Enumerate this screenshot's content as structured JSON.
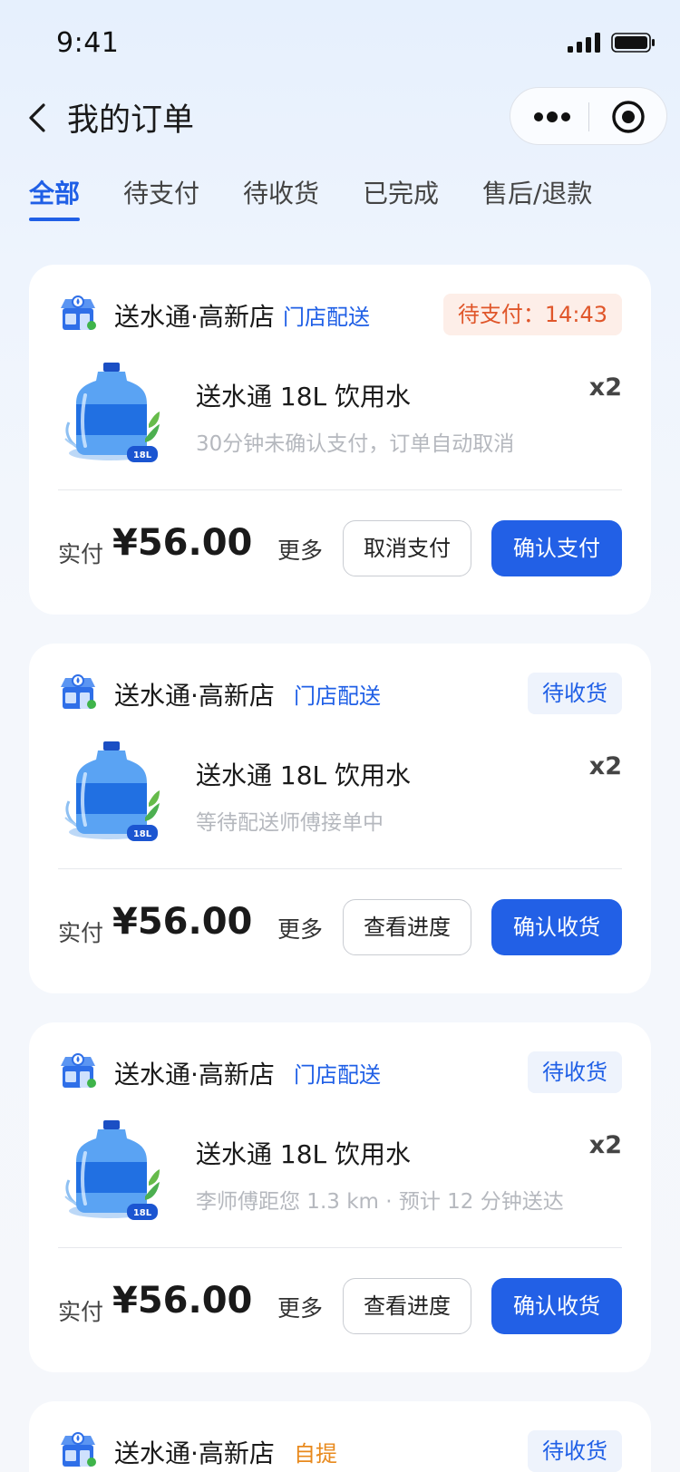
{
  "status_bar": {
    "time": "9:41",
    "signal_icon": "cellular-signal-icon",
    "battery_icon": "battery-icon"
  },
  "nav": {
    "title": "我的订单",
    "back_icon": "chevron-left-icon",
    "more_icon": "more-dots-icon",
    "capsule_icon": "target-circle-icon"
  },
  "tabs": [
    {
      "label": "全部",
      "active": true
    },
    {
      "label": "待支付",
      "active": false
    },
    {
      "label": "待收货",
      "active": false
    },
    {
      "label": "已完成",
      "active": false
    },
    {
      "label": "售后/退款",
      "active": false
    }
  ],
  "orders": [
    {
      "store": "送水通·高新店",
      "delivery": "门店配送",
      "status": "待支付：14:43",
      "product": "送水通 18L 饮用水",
      "qty": "x2",
      "note": "30分钟未确认支付，订单自动取消",
      "paid_label": "实付",
      "amount": "¥56.00",
      "more": "更多",
      "secondary_btn": "取消支付",
      "primary_btn": "确认支付"
    },
    {
      "store": "送水通·高新店",
      "delivery": "门店配送",
      "status": "待收货",
      "product": "送水通 18L 饮用水",
      "qty": "x2",
      "note": "等待配送师傅接单中",
      "paid_label": "实付",
      "amount": "¥56.00",
      "more": "更多",
      "secondary_btn": "查看进度",
      "primary_btn": "确认收货"
    },
    {
      "store": "送水通·高新店",
      "delivery": "门店配送",
      "status": "待收货",
      "product": "送水通 18L 饮用水",
      "qty": "x2",
      "note": "李师傅距您 1.3 km · 预计 12 分钟送达",
      "paid_label": "实付",
      "amount": "¥56.00",
      "more": "更多",
      "secondary_btn": "查看进度",
      "primary_btn": "确认收货"
    },
    {
      "store": "送水通·高新店",
      "delivery": "自提",
      "status": "待收货"
    }
  ],
  "product_badge": "18L",
  "colors": {
    "primary": "#2260e6",
    "tab_active": "#1f5fe6",
    "pay_status": "#e0562a",
    "pickup_tag": "#e8891c",
    "delivery_tag": "#1f5fe6"
  }
}
